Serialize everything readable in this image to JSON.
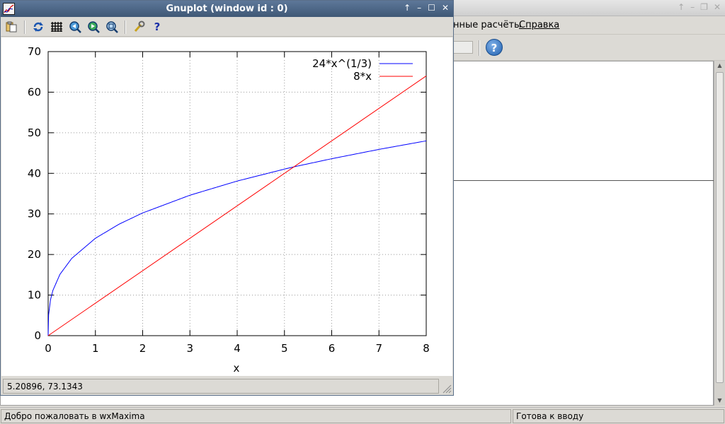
{
  "wxmaxima": {
    "menubar": {
      "numeric_menu_partial": "нные расчёты",
      "help_menu": "Справка"
    },
    "statusbar": {
      "welcome": "Добро пожаловать в wxMaxima",
      "ready": "Готова к вводу"
    },
    "icons": {
      "help": "help-icon"
    }
  },
  "gnuplot": {
    "title": "Gnuplot (window id : 0)",
    "toolbar_icons": [
      "copy-to-clipboard-icon",
      "replot-icon",
      "grid-icon",
      "previous-zoom-icon",
      "next-zoom-icon",
      "autoscale-icon",
      "options-icon",
      "help-icon"
    ],
    "coords": "5.20896,  73.1343",
    "colors": {
      "series1": "#0000ff",
      "series2": "#ff0000",
      "titlebar": "#4a6483"
    }
  },
  "chart_data": {
    "type": "line",
    "xlabel": "x",
    "ylabel": "",
    "xlim": [
      0,
      8
    ],
    "ylim": [
      0,
      70
    ],
    "xticks": [
      0,
      1,
      2,
      3,
      4,
      5,
      6,
      7,
      8
    ],
    "yticks": [
      0,
      10,
      20,
      30,
      40,
      50,
      60,
      70
    ],
    "grid": true,
    "legend_position": "top-right",
    "series": [
      {
        "name": "24*x^(1/3)",
        "color": "#0000ff",
        "x": [
          0,
          0.01,
          0.05,
          0.1,
          0.25,
          0.5,
          1,
          1.5,
          2,
          3,
          4,
          5,
          5.2,
          6,
          7,
          8
        ],
        "y": [
          0,
          5.17,
          8.84,
          11.14,
          15.12,
          19.05,
          24.0,
          27.47,
          30.24,
          34.61,
          38.1,
          41.04,
          41.6,
          43.6,
          45.9,
          48.0
        ]
      },
      {
        "name": "8*x",
        "color": "#ff0000",
        "x": [
          0,
          8
        ],
        "y": [
          0,
          64
        ]
      }
    ]
  }
}
